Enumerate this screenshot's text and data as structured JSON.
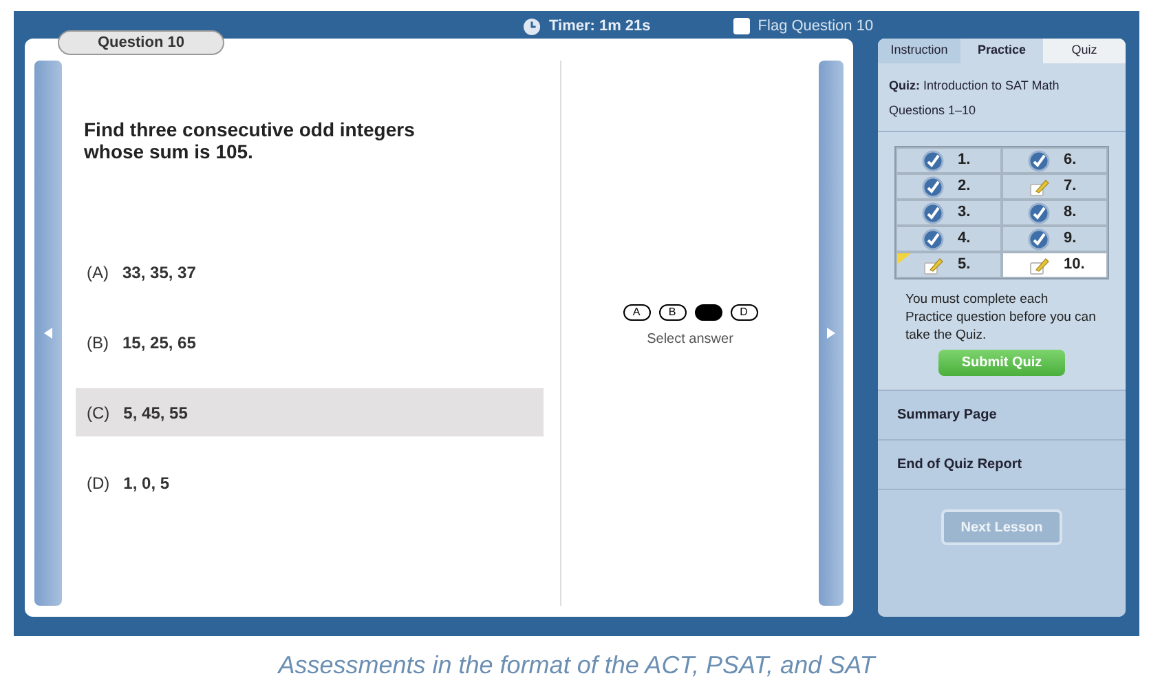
{
  "question_tab": {
    "label": "Question 10"
  },
  "timer": {
    "text": "Timer: 1m 21s"
  },
  "flag": {
    "label": "Flag Question 10",
    "checked": false
  },
  "question": {
    "text": "Find three consecutive odd integers whose sum is 105."
  },
  "options": [
    {
      "letter": "(A)",
      "text": "33, 35, 37",
      "selected": false
    },
    {
      "letter": "(B)",
      "text": "15, 25, 65",
      "selected": false
    },
    {
      "letter": "(C)",
      "text": "5, 45, 55",
      "selected": true
    },
    {
      "letter": "(D)",
      "text": "1, 0, 5",
      "selected": false
    }
  ],
  "bubbles": [
    {
      "label": "A",
      "selected": false
    },
    {
      "label": "B",
      "selected": false
    },
    {
      "selected": true
    },
    {
      "label": "D",
      "selected": false
    }
  ],
  "select_hint": "Select answer",
  "steps": [
    {
      "label": "Instruction",
      "selected": false
    },
    {
      "label": "Practice",
      "selected": true
    },
    {
      "label": "Quiz",
      "selected": false
    }
  ],
  "quiz_info": {
    "heading": "Quiz:",
    "title": "Introduction to SAT Math",
    "subtitle": "Questions 1–10"
  },
  "grid": [
    {
      "label": "1.",
      "kind": "done",
      "flagged": false,
      "selected": false
    },
    {
      "label": "6.",
      "kind": "done",
      "flagged": false,
      "selected": false
    },
    {
      "label": "2.",
      "kind": "done",
      "flagged": false,
      "selected": false
    },
    {
      "label": "7.",
      "kind": "draft",
      "flagged": false,
      "selected": false
    },
    {
      "label": "3.",
      "kind": "done",
      "flagged": false,
      "selected": false
    },
    {
      "label": "8.",
      "kind": "done",
      "flagged": false,
      "selected": false
    },
    {
      "label": "4.",
      "kind": "done",
      "flagged": false,
      "selected": false
    },
    {
      "label": "9.",
      "kind": "done",
      "flagged": false,
      "selected": false
    },
    {
      "label": "5.",
      "kind": "draft",
      "flagged": true,
      "selected": false
    },
    {
      "label": "10.",
      "kind": "draft",
      "flagged": false,
      "selected": true
    }
  ],
  "notice": "You must complete each Practice question before you can take the Quiz.",
  "submit": {
    "label": "Submit Quiz"
  },
  "links": [
    "Summary Page",
    "End of Quiz Report"
  ],
  "next": {
    "label": "Next Lesson",
    "disabled": true
  },
  "caption": "Assessments in the format of the ACT, PSAT, and SAT"
}
